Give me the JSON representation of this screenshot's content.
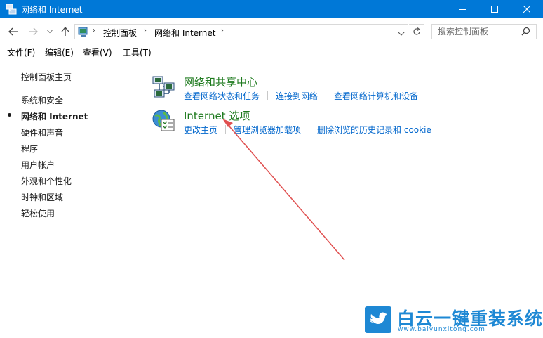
{
  "window": {
    "title": "网络和 Internet",
    "titlebar_color": "#0078d7"
  },
  "address_bar": {
    "breadcrumbs": [
      "控制面板",
      "网络和 Internet"
    ],
    "search_placeholder": "搜索控制面板"
  },
  "menu": [
    "文件(F)",
    "编辑(E)",
    "查看(V)",
    "工具(T)"
  ],
  "sidebar": {
    "home": "控制面板主页",
    "items": [
      {
        "label": "系统和安全",
        "current": false
      },
      {
        "label": "网络和 Internet",
        "current": true
      },
      {
        "label": "硬件和声音",
        "current": false
      },
      {
        "label": "程序",
        "current": false
      },
      {
        "label": "用户帐户",
        "current": false
      },
      {
        "label": "外观和个性化",
        "current": false
      },
      {
        "label": "时钟和区域",
        "current": false
      },
      {
        "label": "轻松使用",
        "current": false
      }
    ]
  },
  "categories": [
    {
      "title": "网络和共享中心",
      "icon": "network-sharing-center-icon",
      "links": [
        "查看网络状态和任务",
        "连接到网络",
        "查看网络计算机和设备"
      ]
    },
    {
      "title": "Internet 选项",
      "icon": "internet-options-icon",
      "links": [
        "更改主页",
        "管理浏览器加载项",
        "删除浏览的历史记录和 cookie"
      ]
    }
  ],
  "annotation": {
    "type": "red-arrow",
    "color": "#e05050"
  },
  "watermark": {
    "title": "白云一键重装系统",
    "url": "www.baiyunxitong.com",
    "color": "#1e88d4"
  },
  "colors": {
    "link": "#0066cc",
    "category_title": "#1e7a1e"
  }
}
